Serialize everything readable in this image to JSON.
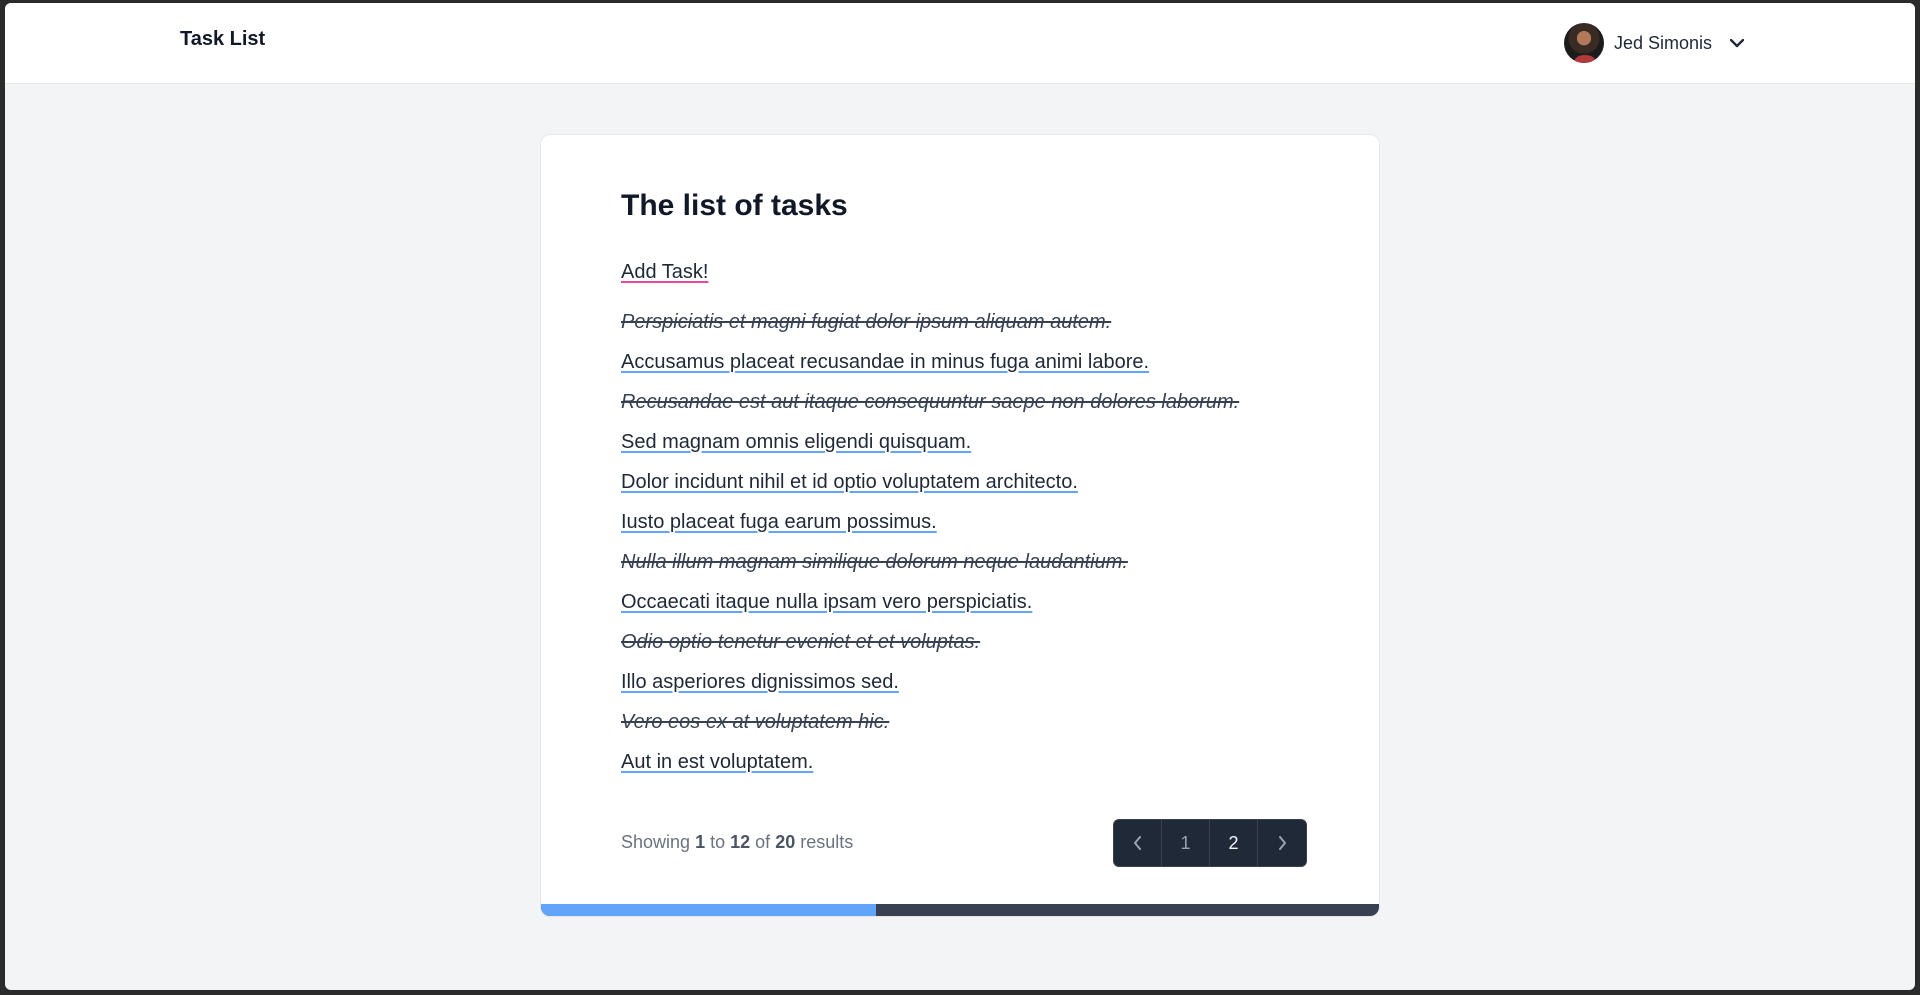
{
  "header": {
    "brand": "Task List",
    "user_name": "Jed Simonis"
  },
  "main": {
    "title": "The list of tasks",
    "add_task_label": "Add Task!",
    "tasks": [
      {
        "text": "Perspiciatis et magni fugiat dolor ipsum aliquam autem.",
        "completed": true
      },
      {
        "text": "Accusamus placeat recusandae in minus fuga animi labore.",
        "completed": false
      },
      {
        "text": "Recusandae est aut itaque consequuntur saepe non dolores laborum.",
        "completed": true
      },
      {
        "text": "Sed magnam omnis eligendi quisquam.",
        "completed": false
      },
      {
        "text": "Dolor incidunt nihil et id optio voluptatem architecto.",
        "completed": false
      },
      {
        "text": "Iusto placeat fuga earum possimus.",
        "completed": false
      },
      {
        "text": "Nulla illum magnam similique dolorum neque laudantium.",
        "completed": true
      },
      {
        "text": "Occaecati itaque nulla ipsam vero perspiciatis.",
        "completed": false
      },
      {
        "text": "Odio optio tenetur eveniet et et voluptas.",
        "completed": true
      },
      {
        "text": "Illo asperiores dignissimos sed.",
        "completed": false
      },
      {
        "text": "Vero eos ex at voluptatem hic.",
        "completed": true
      },
      {
        "text": "Aut in est voluptatem.",
        "completed": false
      }
    ],
    "results": {
      "prefix": "Showing",
      "from": "1",
      "to_word": "to",
      "to": "12",
      "of_word": "of",
      "total": "20",
      "suffix": "results"
    },
    "pagination": {
      "pages": [
        "1",
        "2"
      ],
      "current_page": "2"
    },
    "progress_fraction": 0.4
  },
  "colors": {
    "background": "#f3f4f6",
    "card": "#ffffff",
    "progress_fill": "#60a5fa",
    "progress_track": "#374151",
    "link_underline": "#60a5fa",
    "add_task_underline": "#ec4899",
    "pager_bg": "#1f2937"
  },
  "icons": {
    "user_menu": "chevron-down-icon",
    "prev_page": "chevron-left-icon",
    "next_page": "chevron-right-icon"
  }
}
